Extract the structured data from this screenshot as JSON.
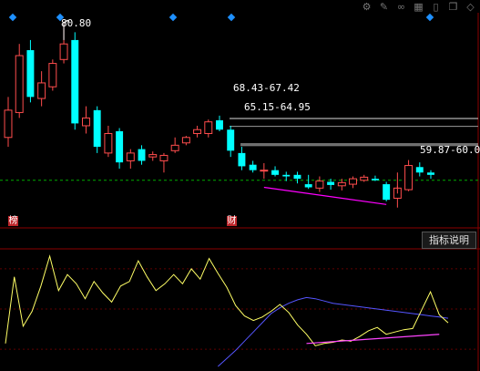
{
  "toolbar": {
    "icons": [
      "gear-icon",
      "pen-icon",
      "glasses-icon",
      "grid-icon",
      "phone-icon",
      "copy-icon",
      "diamond-icon"
    ]
  },
  "upper_chart": {
    "high_label": "80.80",
    "range_labels": [
      "68.43-67.42",
      "65.15-64.95",
      "59.87-60.0"
    ],
    "markers": [
      "榜",
      "财"
    ],
    "colors": {
      "up": "#ff4d4d",
      "down": "#00ffff",
      "ma": "#ffffff",
      "guide": "#00aa00",
      "divergence": "#ff00ff"
    }
  },
  "lower_chart": {
    "button_label": "指标说明",
    "colors": {
      "osc": "#ffff66",
      "sig": "#5555ff",
      "divergence": "#ff44ff",
      "grid": "#600000"
    }
  },
  "chart_data": [
    {
      "type": "candlestick",
      "candles": [
        [
          66.0,
          71.2,
          64.8,
          69.5
        ],
        [
          69.2,
          78.0,
          68.5,
          76.5
        ],
        [
          77.2,
          78.5,
          70.5,
          71.2
        ],
        [
          71.0,
          74.5,
          70.0,
          73.0
        ],
        [
          72.5,
          76.0,
          72.0,
          75.5
        ],
        [
          76.0,
          80.8,
          75.5,
          78.0
        ],
        [
          78.5,
          79.5,
          67.0,
          67.8
        ],
        [
          67.5,
          70.0,
          66.5,
          68.5
        ],
        [
          69.5,
          70.0,
          64.0,
          64.8
        ],
        [
          64.0,
          67.5,
          63.5,
          66.5
        ],
        [
          66.8,
          67.2,
          62.0,
          62.8
        ],
        [
          63.0,
          64.5,
          62.0,
          64.0
        ],
        [
          64.5,
          65.0,
          62.5,
          63.0
        ],
        [
          63.5,
          64.2,
          63.0,
          63.8
        ],
        [
          63.0,
          64.0,
          61.5,
          63.7
        ],
        [
          64.3,
          66.0,
          64.0,
          65.0
        ],
        [
          65.3,
          66.2,
          65.0,
          66.0
        ],
        [
          66.5,
          67.5,
          66.0,
          67.0
        ],
        [
          66.5,
          68.3,
          66.0,
          68.0
        ],
        [
          68.2,
          68.8,
          66.8,
          67.0
        ],
        [
          67.0,
          67.5,
          63.5,
          64.3
        ],
        [
          64.0,
          64.8,
          61.8,
          62.3
        ],
        [
          62.5,
          63.0,
          61.5,
          61.8
        ],
        [
          61.8,
          62.7,
          60.7,
          61.8
        ],
        [
          61.8,
          62.3,
          61.0,
          61.2
        ],
        [
          61.2,
          61.6,
          60.4,
          61.0
        ],
        [
          61.2,
          61.6,
          60.1,
          60.7
        ],
        [
          60.0,
          61.2,
          59.4,
          59.6
        ],
        [
          59.5,
          61.0,
          59.0,
          60.4
        ],
        [
          60.3,
          60.7,
          59.3,
          59.9
        ],
        [
          59.8,
          60.7,
          59.2,
          60.2
        ],
        [
          60.0,
          61.0,
          59.5,
          60.7
        ],
        [
          60.5,
          61.2,
          60.3,
          60.9
        ],
        [
          60.7,
          61.1,
          60.4,
          60.5
        ],
        [
          60.0,
          60.3,
          57.8,
          58.0
        ],
        [
          58.2,
          59.8,
          57.0,
          59.5
        ],
        [
          59.3,
          63.1,
          59.1,
          62.4
        ],
        [
          62.2,
          62.8,
          61.0,
          61.5
        ],
        [
          61.5,
          61.8,
          60.7,
          61.2
        ]
      ],
      "ylim": [
        56.5,
        82.0
      ],
      "ma_level": 60.5,
      "range_lines": [
        [
          68.43,
          67.42
        ],
        [
          65.15,
          64.95
        ]
      ],
      "divergence_line": {
        "from_index": 23,
        "from_value": 59.6,
        "to_index": 34,
        "to_value": 57.4
      }
    },
    {
      "type": "line",
      "series": [
        {
          "values": [
            20,
            78,
            35,
            48,
            70,
            96,
            66,
            80,
            72,
            59,
            74,
            64,
            56,
            70,
            74,
            92,
            78,
            66,
            72,
            80,
            72,
            85,
            76,
            94,
            81,
            69,
            53,
            44,
            40,
            43,
            48,
            54,
            47,
            36,
            28,
            18,
            20,
            21,
            23,
            22,
            26,
            31,
            34,
            28,
            30,
            32,
            33,
            49,
            65,
            45,
            38
          ]
        },
        {
          "values": [
            null,
            null,
            null,
            null,
            null,
            null,
            null,
            null,
            null,
            null,
            null,
            null,
            null,
            null,
            null,
            null,
            null,
            null,
            null,
            null,
            null,
            null,
            null,
            null,
            0,
            7,
            14,
            22,
            30,
            38,
            46,
            51,
            55,
            58,
            60,
            59,
            57,
            55,
            54,
            53,
            52,
            51,
            50,
            49,
            48,
            47,
            46,
            45,
            44,
            43,
            42
          ]
        }
      ],
      "ylim": [
        0,
        100
      ],
      "gridlines": [
        15,
        50,
        85
      ],
      "divergence_line": {
        "from_index": 34,
        "from_value": 20,
        "to_index": 49,
        "to_value": 28
      }
    }
  ]
}
